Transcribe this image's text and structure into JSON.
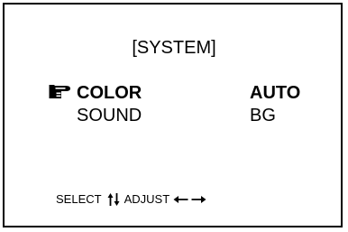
{
  "menu": {
    "title": "[SYSTEM]",
    "items": [
      {
        "label": "COLOR",
        "value": "AUTO",
        "selected": true
      },
      {
        "label": "SOUND",
        "value": "BG",
        "selected": false
      }
    ],
    "pointer_icon": "pointing-hand-icon"
  },
  "footer": {
    "select_label": "SELECT",
    "select_icon": "up-down-arrows-icon",
    "adjust_label": "ADJUST",
    "adjust_icons": [
      "left-arrow-icon",
      "right-arrow-icon"
    ]
  },
  "colors": {
    "background": "#ffffff",
    "foreground": "#000000"
  }
}
